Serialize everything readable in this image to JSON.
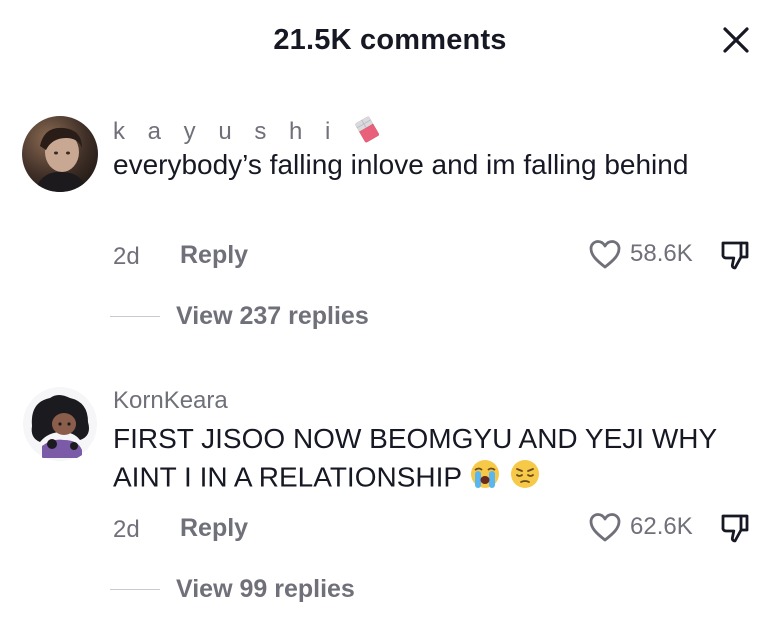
{
  "header": {
    "title": "21.5K comments",
    "close_icon": "close-icon"
  },
  "comments": [
    {
      "username": "k a y u s h i",
      "username_emoji": "chocolate-bar-emoji",
      "text": "everybody’s falling inlove and im falling behind",
      "time": "2d",
      "reply_label": "Reply",
      "likes": "58.6K",
      "view_replies": "View 237 replies"
    },
    {
      "username": "KornKeara",
      "text": "FIRST JISOO NOW BEOMGYU AND YEJI WHY AINT I IN A RELATIONSHIP",
      "text_emojis": [
        "loudly-crying-face-emoji",
        "pensive-face-emoji"
      ],
      "time": "2d",
      "reply_label": "Reply",
      "likes": "62.6K",
      "view_replies": "View 99 replies"
    }
  ],
  "colors": {
    "primary_text": "#161823",
    "secondary_text": "#6f7079",
    "background": "#ffffff"
  }
}
